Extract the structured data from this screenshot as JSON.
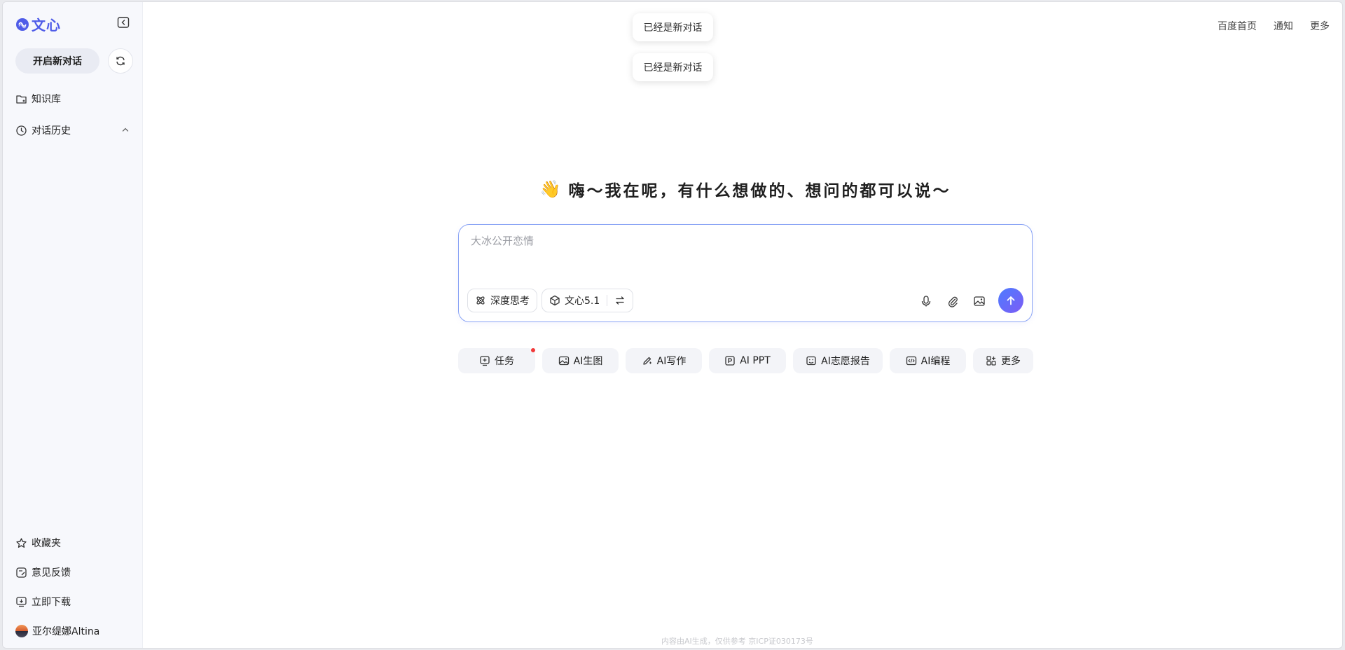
{
  "app": {
    "logo_text": "文心",
    "brand_color": "#4f5ce8"
  },
  "sidebar": {
    "new_chat_label": "开启新对话",
    "top_items": [
      {
        "label": "知识库",
        "icon": "folder-icon"
      },
      {
        "label": "对话历史",
        "icon": "clock-icon"
      }
    ],
    "bottom_items": [
      {
        "label": "收藏夹",
        "icon": "star-icon"
      },
      {
        "label": "意见反馈",
        "icon": "feedback-icon"
      },
      {
        "label": "立即下载",
        "icon": "download-icon"
      }
    ],
    "user_name": "亚尔缇娜Altina"
  },
  "header": {
    "links": [
      "百度首页",
      "通知",
      "更多"
    ]
  },
  "toasts": [
    "已经是新对话",
    "已经是新对话"
  ],
  "main": {
    "greeting_emoji": "👋",
    "greeting": "嗨～我在呢，有什么想做的、想问的都可以说～",
    "input_placeholder": "大冰公开恋情",
    "deep_think_label": "深度思考",
    "model_label": "文心5.1",
    "send_color": "#5b6ef5"
  },
  "quick_actions": [
    {
      "label": "任务",
      "icon": "task-icon",
      "badge": true
    },
    {
      "label": "AI生图",
      "icon": "image-gen-icon"
    },
    {
      "label": "AI写作",
      "icon": "pen-icon"
    },
    {
      "label": "AI PPT",
      "icon": "ppt-icon"
    },
    {
      "label": "AI志愿报告",
      "icon": "report-icon"
    },
    {
      "label": "AI编程",
      "icon": "code-icon"
    },
    {
      "label": "更多",
      "icon": "grid-plus-icon"
    }
  ],
  "footer": "内容由AI生成，仅供参考 京ICP证030173号"
}
